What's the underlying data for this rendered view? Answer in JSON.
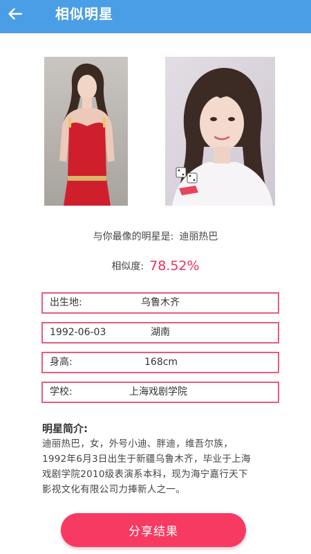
{
  "header": {
    "title": "相似明星",
    "back_icon": "arrow-left-icon"
  },
  "photos": {
    "left": "user-photo",
    "right": "celebrity-photo"
  },
  "result": {
    "best_match_label": "与你最像的明星是:",
    "best_match_name": "迪丽热巴",
    "similarity_label": "相似度:",
    "similarity_value": "78.52%"
  },
  "info": {
    "birthplace_label": "出生地:",
    "birthplace_value": "乌鲁木齐",
    "birthday": "1992-06-03",
    "province": "湖南",
    "height_label": "身高:",
    "height_value": "168cm",
    "school_label": "学校:",
    "school_value": "上海戏剧学院"
  },
  "intro": {
    "title": "明星简介:",
    "lines": [
      "迪丽热巴，女，外号小迪、胖迪，维吾尔族，",
      "1992年6月3日出生于新疆乌鲁木齐，毕业于上海",
      "戏剧学院2010级表演系本科，现为海宁嘉行天下",
      "影视文化有限公司力捧新人之一。"
    ]
  },
  "actions": {
    "share_label": "分享结果"
  },
  "colors": {
    "header": "#4a9ee6",
    "accent": "#ee2f5c",
    "box_border": "#e85a7c",
    "button": "#f73a62"
  }
}
